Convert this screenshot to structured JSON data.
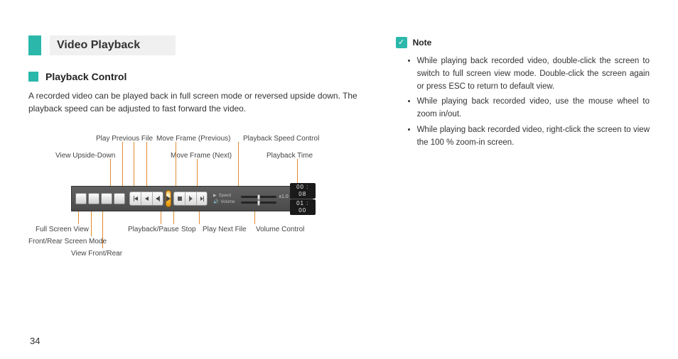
{
  "section": {
    "title": "Video Playback"
  },
  "subsection": {
    "title": "Playback Control"
  },
  "body": "A recorded video can be played back in full screen mode or reversed upside down. The playback speed can be adjusted to fast forward the video.",
  "labels": {
    "top": {
      "play_prev_file": "Play Previous File",
      "move_frame_prev": "Move Frame (Previous)",
      "playback_speed_ctrl": "Playback Speed Control",
      "view_upside_down": "View Upside-Down",
      "move_frame_next": "Move Frame (Next)",
      "playback_time": "Playback Time"
    },
    "bottom": {
      "full_screen_view": "Full Screen View",
      "playback_pause": "Playback/Pause",
      "stop": "Stop",
      "play_next_file": "Play Next File",
      "volume_control": "Volume Control",
      "front_rear_mode": "Front/Rear Screen Mode",
      "view_front_rear": "View Front/Rear"
    }
  },
  "player": {
    "speed_label": "Speed",
    "volume_label": "Volume",
    "speed_value": "x1.0",
    "time_current": "00 : 08",
    "time_total": "01 : 00"
  },
  "note": {
    "title": "Note",
    "items": [
      "While playing back recorded video, double-click the screen to switch to full screen view mode. Double-click the screen again or press ESC to return to default view.",
      "While playing back recorded video, use the mouse wheel to zoom in/out.",
      "While playing back recorded video, right-click the screen to view the 100 % zoom-in screen."
    ]
  },
  "page_number": "34"
}
